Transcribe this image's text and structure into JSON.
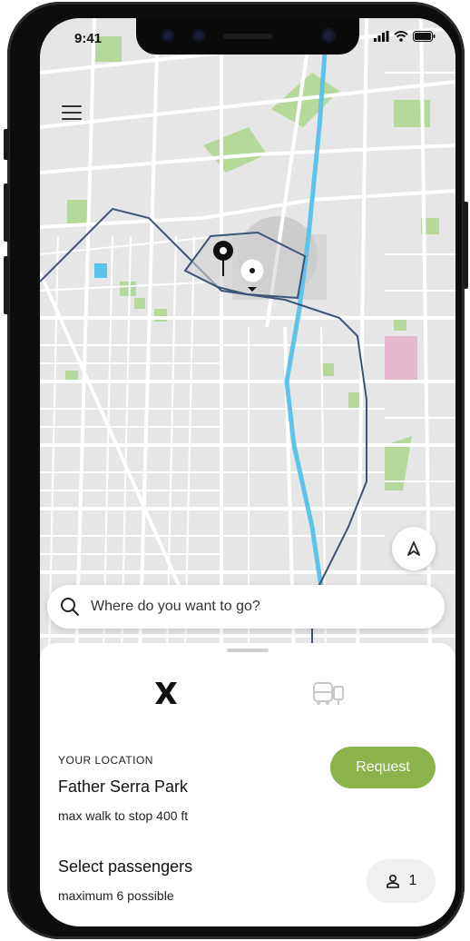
{
  "status_bar": {
    "time": "9:41"
  },
  "map": {
    "menu_icon": "hamburger-menu-icon",
    "navigate_icon": "navigation-arrow-icon",
    "pin_icon": "map-pin-icon",
    "colors": {
      "land": "#e6e6e6",
      "road": "#ffffff",
      "park": "#b5d99a",
      "water": "#5ec3ea",
      "zone_outline": "#3d5476"
    }
  },
  "search": {
    "placeholder": "Where do you want to go?",
    "icon": "search-icon"
  },
  "modes": [
    {
      "name": "x-mode",
      "icon": "x-logo-icon",
      "active": true
    },
    {
      "name": "bus-mode",
      "icon": "bus-icon",
      "active": false
    }
  ],
  "location": {
    "label": "YOUR LOCATION",
    "name": "Father Serra Park",
    "detail": "max walk to stop 400 ft"
  },
  "request_button": {
    "label": "Request",
    "color": "#8ab44b"
  },
  "passengers": {
    "title": "Select passengers",
    "detail": "maximum 6 possible",
    "count": "1",
    "icon": "person-icon"
  }
}
